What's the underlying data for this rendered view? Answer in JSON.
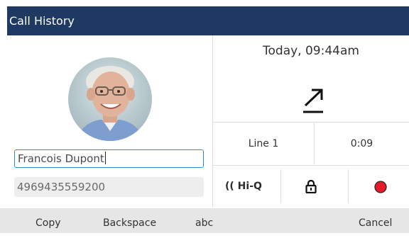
{
  "header": {
    "title": "Call History"
  },
  "contact": {
    "name": "Francois Dupont",
    "number": "4969435559200"
  },
  "call": {
    "datetime": "Today, 09:44am",
    "direction_icon": "outgoing-call-arrow-icon",
    "line": "Line 1",
    "duration": "0:09",
    "hiq_label": "Hi-Q",
    "icons": [
      "hiq-icon",
      "lock-icon",
      "record-icon"
    ]
  },
  "softkeys": {
    "copy": "Copy",
    "backspace": "Backspace",
    "mode": "abc",
    "cancel": "Cancel"
  },
  "colors": {
    "titlebar": "#1e3a63",
    "focus_border": "#2f8fc4",
    "record": "#e8182b"
  }
}
